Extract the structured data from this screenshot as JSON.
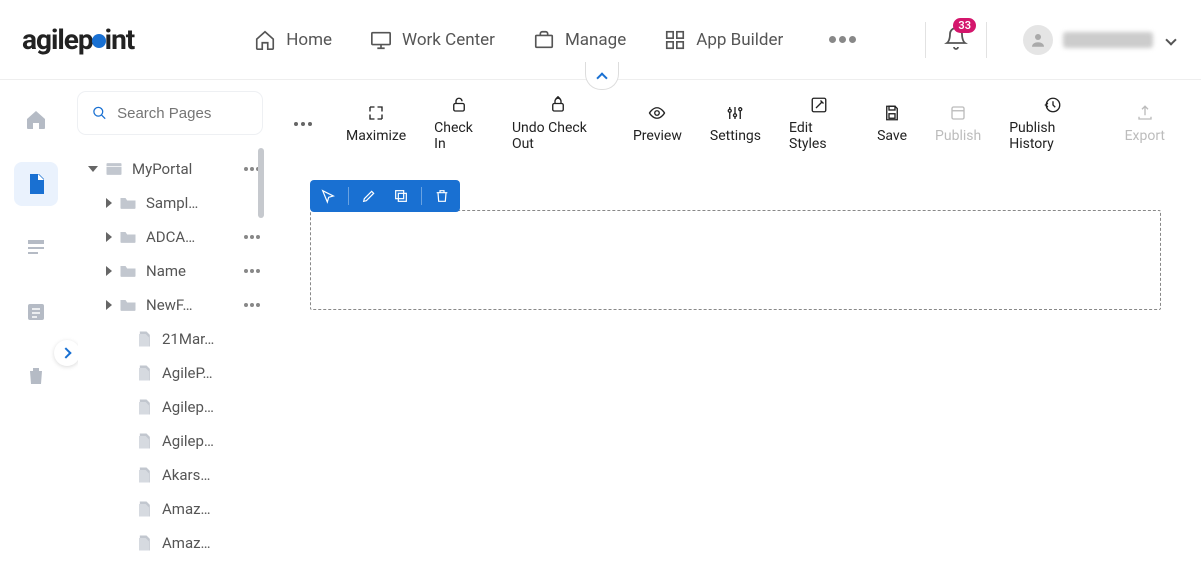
{
  "brand": {
    "name": "agilepoint"
  },
  "topnav": {
    "items": [
      {
        "label": "Home"
      },
      {
        "label": "Work Center"
      },
      {
        "label": "Manage"
      },
      {
        "label": "App Builder"
      }
    ],
    "notification_count": "33"
  },
  "rail": {
    "items": [
      "home",
      "page-builder",
      "forms",
      "data",
      "trash"
    ],
    "active_index": 1
  },
  "sidebar": {
    "search_placeholder": "Search Pages",
    "tree": [
      {
        "kind": "site",
        "indent": 0,
        "caret": "down",
        "label": "MyPortal",
        "more": true
      },
      {
        "kind": "folder",
        "indent": 1,
        "caret": "right",
        "label": "Sampl…",
        "more": false
      },
      {
        "kind": "folder",
        "indent": 1,
        "caret": "right",
        "label": "ADCA…",
        "more": true
      },
      {
        "kind": "folder",
        "indent": 1,
        "caret": "right",
        "label": "Name",
        "more": true
      },
      {
        "kind": "folder",
        "indent": 1,
        "caret": "right",
        "label": "NewF…",
        "more": true
      },
      {
        "kind": "page",
        "indent": 2,
        "caret": "",
        "label": "21Mar…",
        "more": false
      },
      {
        "kind": "page",
        "indent": 2,
        "caret": "",
        "label": "AgileP…",
        "more": false
      },
      {
        "kind": "page",
        "indent": 2,
        "caret": "",
        "label": "Agilep…",
        "more": false
      },
      {
        "kind": "page",
        "indent": 2,
        "caret": "",
        "label": "Agilep…",
        "more": false
      },
      {
        "kind": "page",
        "indent": 2,
        "caret": "",
        "label": "Akars…",
        "more": false
      },
      {
        "kind": "page",
        "indent": 2,
        "caret": "",
        "label": "Amaz…",
        "more": false
      },
      {
        "kind": "page",
        "indent": 2,
        "caret": "",
        "label": "Amaz…",
        "more": false
      }
    ]
  },
  "toolbar": {
    "items": [
      {
        "id": "maximize",
        "label": "Maximize",
        "disabled": false
      },
      {
        "id": "checkin",
        "label": "Check In",
        "disabled": false
      },
      {
        "id": "undocheckout",
        "label": "Undo Check Out",
        "disabled": false
      },
      {
        "id": "preview",
        "label": "Preview",
        "disabled": false
      },
      {
        "id": "settings",
        "label": "Settings",
        "disabled": false
      },
      {
        "id": "editstyles",
        "label": "Edit Styles",
        "disabled": false
      },
      {
        "id": "save",
        "label": "Save",
        "disabled": false
      },
      {
        "id": "publish",
        "label": "Publish",
        "disabled": true
      },
      {
        "id": "publishhistory",
        "label": "Publish History",
        "disabled": false
      },
      {
        "id": "export",
        "label": "Export",
        "disabled": true
      }
    ]
  },
  "selection_toolbar": {
    "actions": [
      "move",
      "edit",
      "duplicate",
      "delete"
    ]
  }
}
